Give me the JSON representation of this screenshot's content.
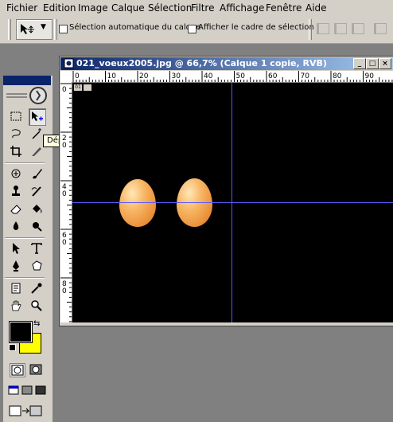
{
  "menu": [
    {
      "label": "Fichier"
    },
    {
      "label": "Edition"
    },
    {
      "label": "Image"
    },
    {
      "label": "Calque"
    },
    {
      "label": "Sélection"
    },
    {
      "label": "Filtre"
    },
    {
      "label": "Affichage"
    },
    {
      "label": "Fenêtre"
    },
    {
      "label": "Aide"
    }
  ],
  "options": {
    "auto_select_label": "Sélection automatique du calque",
    "show_bounds_label": "Afficher le cadre de sélection",
    "auto_select_checked": false,
    "show_bounds_checked": false
  },
  "tooltip": "Déplacement (V)",
  "document": {
    "title": "021_voeux2005.jpg @ 66,7% (Calque 1 copie, RVB)",
    "zoom_percent": 66.7,
    "ruler_h_labels": [
      "0",
      "10",
      "20",
      "30",
      "40",
      "50",
      "60",
      "70",
      "80",
      "90"
    ],
    "ruler_v_labels": [
      "0",
      "2\n0",
      "4\n0",
      "6\n0",
      "8\n0"
    ]
  },
  "colors": {
    "foreground": "#000000",
    "background": "#ffff00",
    "guide": "#5a5aff",
    "canvas": "#000000"
  },
  "toolbox_icons": [
    "marquee-icon",
    "move-icon",
    "lasso-icon",
    "magic-wand-icon",
    "crop-icon",
    "slice-icon",
    "healing-brush-icon",
    "brush-icon",
    "clone-stamp-icon",
    "history-brush-icon",
    "eraser-icon",
    "paint-bucket-icon",
    "blur-icon",
    "dodge-icon",
    "path-select-icon",
    "type-icon",
    "pen-icon",
    "custom-shape-icon",
    "notes-icon",
    "eyedropper-icon",
    "hand-icon",
    "zoom-icon"
  ]
}
